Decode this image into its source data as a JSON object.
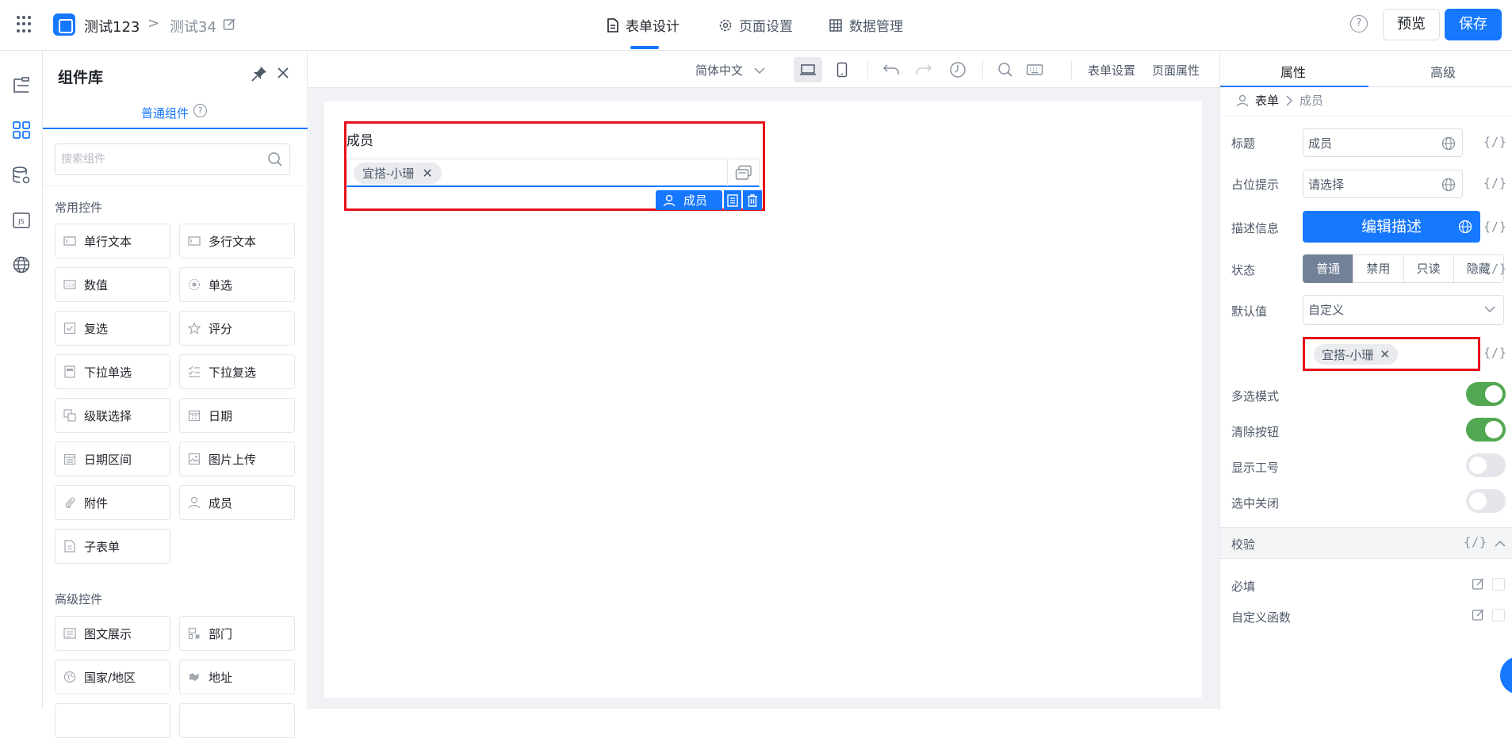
{
  "header": {
    "app_name": "测试123",
    "breadcrumb_sep": ">",
    "page_name": "测试34",
    "tabs": [
      {
        "label": "表单设计",
        "icon": "document-icon"
      },
      {
        "label": "页面设置",
        "icon": "gear-icon"
      },
      {
        "label": "数据管理",
        "icon": "table-icon"
      }
    ],
    "help": "?",
    "preview_label": "预览",
    "save_label": "保存"
  },
  "component_panel": {
    "title": "组件库",
    "subtab": "普通组件",
    "subtab_help": "?",
    "search_placeholder": "搜索组件",
    "groups": [
      {
        "title": "常用控件",
        "items": [
          {
            "label": "单行文本",
            "icon": "single-line-text-icon"
          },
          {
            "label": "多行文本",
            "icon": "multi-line-text-icon"
          },
          {
            "label": "数值",
            "icon": "number-icon"
          },
          {
            "label": "单选",
            "icon": "radio-icon"
          },
          {
            "label": "复选",
            "icon": "checkbox-icon"
          },
          {
            "label": "评分",
            "icon": "star-icon"
          },
          {
            "label": "下拉单选",
            "icon": "dropdown-single-icon"
          },
          {
            "label": "下拉复选",
            "icon": "dropdown-multi-icon"
          },
          {
            "label": "级联选择",
            "icon": "cascade-icon"
          },
          {
            "label": "日期",
            "icon": "calendar-icon"
          },
          {
            "label": "日期区间",
            "icon": "date-range-icon"
          },
          {
            "label": "图片上传",
            "icon": "image-upload-icon"
          },
          {
            "label": "附件",
            "icon": "paperclip-icon"
          },
          {
            "label": "成员",
            "icon": "user-icon"
          },
          {
            "label": "子表单",
            "icon": "subform-icon"
          }
        ]
      },
      {
        "title": "高级控件",
        "items": [
          {
            "label": "图文展示",
            "icon": "rich-text-icon"
          },
          {
            "label": "部门",
            "icon": "department-icon"
          },
          {
            "label": "国家/地区",
            "icon": "globe-icon"
          },
          {
            "label": "地址",
            "icon": "map-icon"
          }
        ]
      }
    ]
  },
  "toolbar": {
    "language": "简体中文",
    "form_settings": "表单设置",
    "page_properties": "页面属性"
  },
  "canvas": {
    "field_label": "成员",
    "field_tag": "宜搭-小珊",
    "selected_badge": "成员"
  },
  "properties": {
    "tabs": [
      "属性",
      "高级"
    ],
    "breadcrumb": {
      "root": "表单",
      "current": "成员"
    },
    "rows": {
      "title_label": "标题",
      "title_value": "成员",
      "placeholder_label": "占位提示",
      "placeholder_value": "请选择",
      "description_label": "描述信息",
      "description_button": "编辑描述",
      "state_label": "状态",
      "state_options": [
        "普通",
        "禁用",
        "只读",
        "隐藏"
      ],
      "state_selected": "普通",
      "default_label": "默认值",
      "default_mode": "自定义",
      "default_tag": "宜搭-小珊",
      "expr": "{/}"
    },
    "toggles": [
      {
        "label": "多选模式",
        "on": true
      },
      {
        "label": "清除按钮",
        "on": true
      },
      {
        "label": "显示工号",
        "on": false
      },
      {
        "label": "选中关闭",
        "on": false
      }
    ],
    "validation": {
      "title": "校验",
      "expr": "{/}",
      "rules": [
        {
          "label": "必填",
          "checked": false
        },
        {
          "label": "自定义函数",
          "checked": false
        }
      ]
    }
  },
  "colors": {
    "accent": "#1677ff",
    "highlight": "#e8101a",
    "toggle_on": "#52a852"
  }
}
